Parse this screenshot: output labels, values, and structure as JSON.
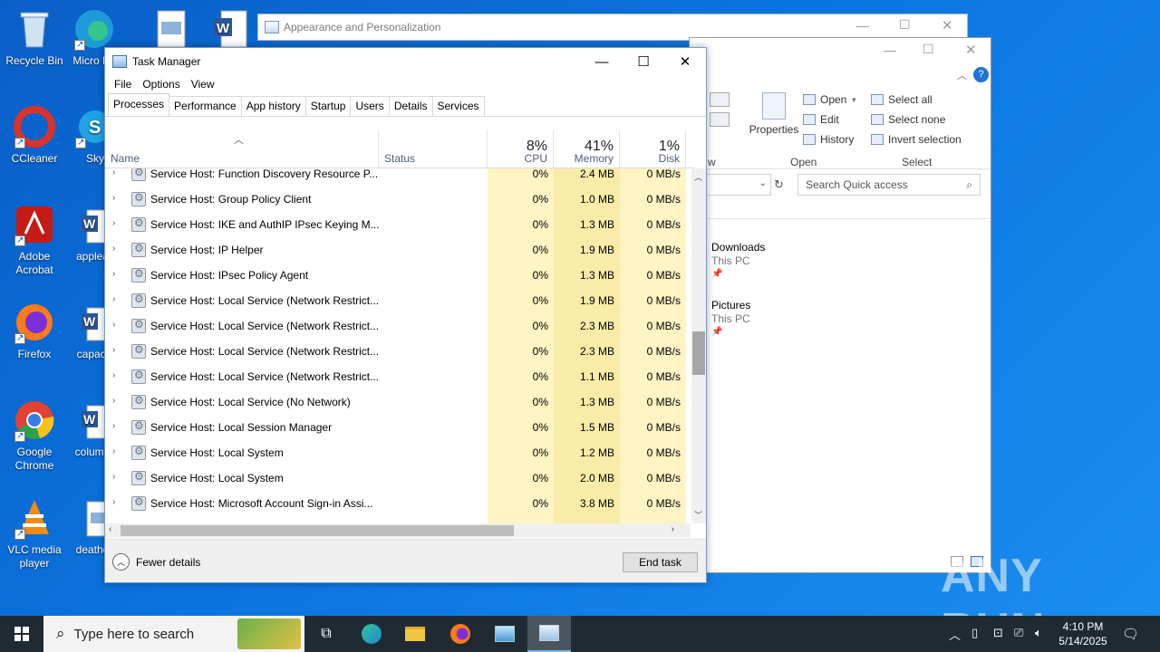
{
  "desktop": {
    "icons": [
      {
        "label": "Recycle Bin"
      },
      {
        "label": "Micro Ed"
      },
      {
        "label": "CCleaner"
      },
      {
        "label": "Sky"
      },
      {
        "label": "Adobe Acrobat"
      },
      {
        "label": "applea"
      },
      {
        "label": "Firefox"
      },
      {
        "label": "capaci"
      },
      {
        "label": "Google Chrome"
      },
      {
        "label": "column"
      },
      {
        "label": "VLC media player"
      },
      {
        "label": "deatho"
      }
    ]
  },
  "explorer_back": {
    "title": "Appearance and Personalization"
  },
  "explorer": {
    "ribbon": {
      "properties": "Properties",
      "open": "Open",
      "edit": "Edit",
      "history": "History",
      "open_group": "Open",
      "select_all": "Select all",
      "select_none": "Select none",
      "invert_selection": "Invert selection",
      "select_group": "Select",
      "view_partial": "w"
    },
    "search_placeholder": "Search Quick access",
    "items": [
      {
        "name": "Downloads",
        "location": "This PC"
      },
      {
        "name": "Pictures",
        "location": "This PC"
      }
    ]
  },
  "task_manager": {
    "title": "Task Manager",
    "menu": [
      "File",
      "Options",
      "View"
    ],
    "tabs": [
      "Processes",
      "Performance",
      "App history",
      "Startup",
      "Users",
      "Details",
      "Services"
    ],
    "active_tab": "Processes",
    "columns": {
      "name": "Name",
      "status": "Status",
      "cpu": {
        "pct": "8%",
        "label": "CPU"
      },
      "memory": {
        "pct": "41%",
        "label": "Memory"
      },
      "disk": {
        "pct": "1%",
        "label": "Disk"
      }
    },
    "rows": [
      {
        "name": "Service Host: Function Discovery Resource P...",
        "cpu": "0%",
        "mem": "2.4 MB",
        "disk": "0 MB/s"
      },
      {
        "name": "Service Host: Group Policy Client",
        "cpu": "0%",
        "mem": "1.0 MB",
        "disk": "0 MB/s"
      },
      {
        "name": "Service Host: IKE and AuthIP IPsec Keying M...",
        "cpu": "0%",
        "mem": "1.3 MB",
        "disk": "0 MB/s"
      },
      {
        "name": "Service Host: IP Helper",
        "cpu": "0%",
        "mem": "1.9 MB",
        "disk": "0 MB/s"
      },
      {
        "name": "Service Host: IPsec Policy Agent",
        "cpu": "0%",
        "mem": "1.3 MB",
        "disk": "0 MB/s"
      },
      {
        "name": "Service Host: Local Service (Network Restrict...",
        "cpu": "0%",
        "mem": "1.9 MB",
        "disk": "0 MB/s"
      },
      {
        "name": "Service Host: Local Service (Network Restrict...",
        "cpu": "0%",
        "mem": "2.3 MB",
        "disk": "0 MB/s"
      },
      {
        "name": "Service Host: Local Service (Network Restrict...",
        "cpu": "0%",
        "mem": "2.3 MB",
        "disk": "0 MB/s"
      },
      {
        "name": "Service Host: Local Service (Network Restrict...",
        "cpu": "0%",
        "mem": "1.1 MB",
        "disk": "0 MB/s"
      },
      {
        "name": "Service Host: Local Service (No Network)",
        "cpu": "0%",
        "mem": "1.3 MB",
        "disk": "0 MB/s"
      },
      {
        "name": "Service Host: Local Session Manager",
        "cpu": "0%",
        "mem": "1.5 MB",
        "disk": "0 MB/s"
      },
      {
        "name": "Service Host: Local System",
        "cpu": "0%",
        "mem": "1.2 MB",
        "disk": "0 MB/s"
      },
      {
        "name": "Service Host: Local System",
        "cpu": "0%",
        "mem": "2.0 MB",
        "disk": "0 MB/s"
      },
      {
        "name": "Service Host: Microsoft Account Sign-in Assi...",
        "cpu": "0%",
        "mem": "3.8 MB",
        "disk": "0 MB/s"
      }
    ],
    "fewer_details": "Fewer details",
    "end_task": "End task"
  },
  "taskbar": {
    "search_placeholder": "Type here to search",
    "time": "4:10 PM",
    "date": "5/14/2025"
  },
  "watermark": "ANY RUN",
  "colors": {
    "desktop": "#0b74e0",
    "cpu_col": "#fff4c4",
    "mem_col": "#f9eca8",
    "taskbar": "#1f2a33"
  }
}
